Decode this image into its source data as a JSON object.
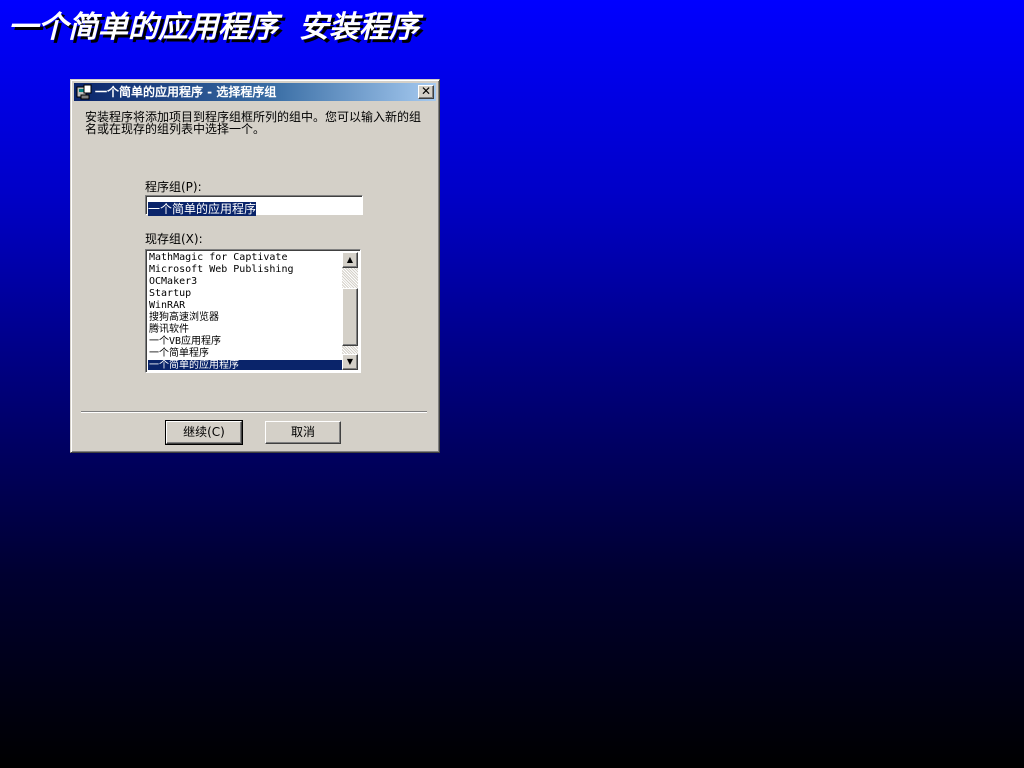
{
  "setup_title": "一个简单的应用程序  安装程序",
  "dialog": {
    "title": "一个简单的应用程序 - 选择程序组",
    "close_glyph": "✕",
    "description": "安装程序将添加项目到程序组框所列的组中。您可以输入新的组名或在现存的组列表中选择一个。",
    "group_label": "程序组(P):",
    "group_value": "一个简单的应用程序",
    "existing_label": "现存组(X):",
    "existing_groups": [
      "MathMagic for Captivate",
      "Microsoft Web Publishing",
      "OCMaker3",
      "Startup",
      "WinRAR",
      "搜狗高速浏览器",
      "腾讯软件",
      "一个VB应用程序",
      "一个简单程序",
      "一个简单的应用程序"
    ],
    "selected_index": 9,
    "continue_label": "继续(C)",
    "cancel_label": "取消",
    "scroll_up_glyph": "▲",
    "scroll_down_glyph": "▼"
  },
  "icons": {
    "titlebar": "setup-icon",
    "close": "close-icon",
    "scroll_up": "scroll-up-icon",
    "scroll_down": "scroll-down-icon"
  },
  "colors": {
    "background_top": "#0000ff",
    "background_bottom": "#000000",
    "titlebar_active": "#0a246a",
    "selection": "#0a246a",
    "dialog_face": "#d4d0c8"
  }
}
